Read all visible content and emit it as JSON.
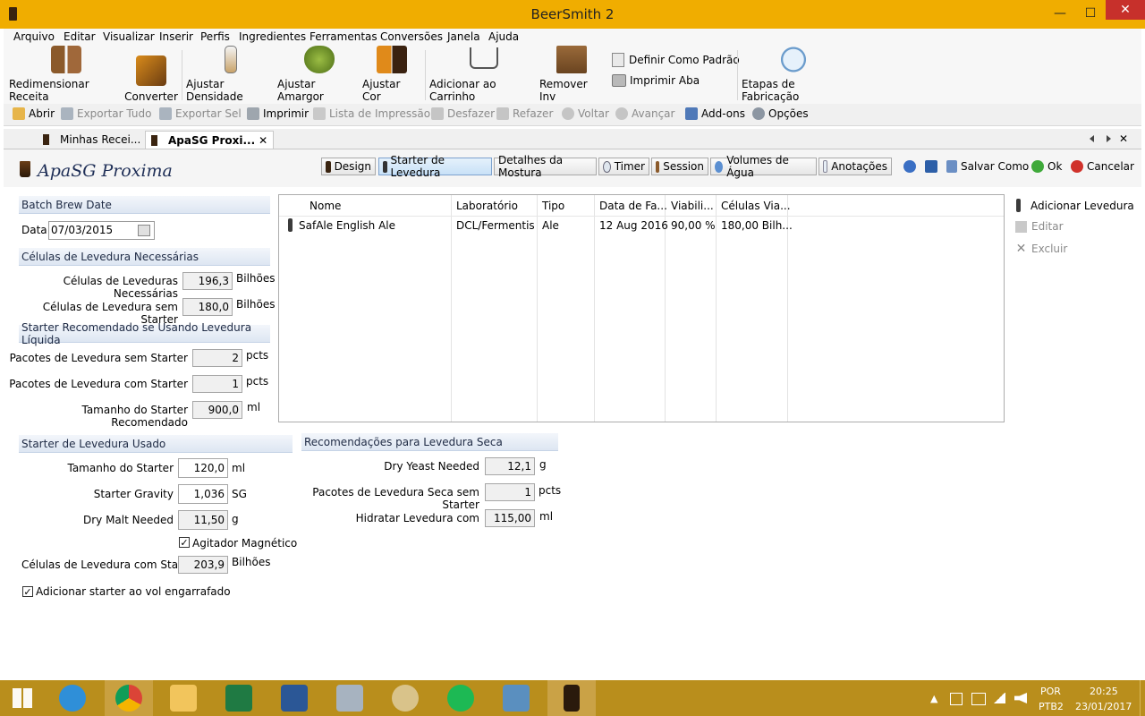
{
  "window": {
    "title": "BeerSmith 2",
    "minimize": "—",
    "maximize": "☐",
    "close": "✕"
  },
  "menu": [
    "Arquivo",
    "Editar",
    "Visualizar",
    "Inserir",
    "Perfis",
    "Ingredientes",
    "Ferramentas",
    "Conversões",
    "Janela",
    "Ajuda"
  ],
  "ribbon": {
    "resize": "Redimensionar Receita",
    "convert": "Converter",
    "density": "Ajustar Densidade",
    "bitterness": "Ajustar Amargor",
    "color": "Ajustar Cor",
    "add_cart": "Adicionar ao Carrinho",
    "remove_inv": "Remover Inv",
    "set_default": "Definir Como Padrão",
    "print_tab": "Imprimir Aba",
    "brew_steps": "Etapas de Fabricação"
  },
  "toolbar": {
    "open": "Abrir",
    "export_all": "Exportar Tudo",
    "export_sel": "Exportar Sel",
    "print": "Imprimir",
    "print_list": "Lista de Impressão",
    "undo": "Desfazer",
    "redo": "Refazer",
    "back": "Voltar",
    "forward": "Avançar",
    "addons": "Add-ons",
    "options": "Opções"
  },
  "doc_tabs": {
    "tab1": "Minhas Recei...",
    "tab2": "ApaSG  Proxi...",
    "close": "✕"
  },
  "recipe": {
    "title": "ApaSG  Proxima"
  },
  "view_tabs": {
    "design": "Design",
    "starter": "Starter de Levedura",
    "mash": "Detalhes da Mostura",
    "timer": "Timer",
    "session": "Session",
    "water": "Volumes de Água",
    "notes": "Anotações"
  },
  "actions": {
    "save_as": "Salvar Como",
    "ok": "Ok",
    "cancel": "Cancelar"
  },
  "batch": {
    "header": "Batch Brew Date",
    "date_label": "Data",
    "date_value": "07/03/2015"
  },
  "cells_needed": {
    "header": "Células de Levedura Necessárias",
    "needed_label": "Células de Leveduras Necessárias",
    "needed_value": "196,3",
    "needed_unit": "Bilhões",
    "nostarter_label": "Células de Levedura sem Starter",
    "nostarter_value": "180,0",
    "nostarter_unit": "Bilhões"
  },
  "liquid": {
    "header": "Starter Recomendado se Usando Levedura Líquida",
    "p_no_label": "Pacotes de Levedura sem Starter",
    "p_no_value": "2",
    "p_no_unit": "pcts",
    "p_with_label": "Pacotes de Levedura com Starter",
    "p_with_value": "1",
    "p_with_unit": "pcts",
    "size_label": "Tamanho do Starter Recomendado",
    "size_value": "900,0",
    "size_unit": "ml"
  },
  "used": {
    "header": "Starter de Levedura Usado",
    "size_label": "Tamanho do Starter",
    "size_value": "120,0",
    "size_unit": "ml",
    "gravity_label": "Starter Gravity",
    "gravity_value": "1,036",
    "gravity_unit": "SG",
    "malt_label": "Dry Malt Needed",
    "malt_value": "11,50",
    "malt_unit": "g",
    "stir_label": "Agitador Magnético",
    "cells_label": "Células de Levedura com Starter",
    "cells_value": "203,9",
    "cells_unit": "Bilhões",
    "add_label": "Adicionar starter ao vol engarrafado"
  },
  "dry": {
    "header": "Recomendações para Levedura Seca",
    "need_label": "Dry Yeast Needed",
    "need_value": "12,1",
    "need_unit": "g",
    "packs_label": "Pacotes de Levedura Seca sem Starter",
    "packs_value": "1",
    "packs_unit": "pcts",
    "hydrate_label": "Hidratar Levedura com",
    "hydrate_value": "115,00",
    "hydrate_unit": "ml"
  },
  "grid": {
    "columns": [
      "Nome",
      "Laboratório",
      "Tipo",
      "Data de Fa...",
      "Viabili...",
      "Células Via..."
    ],
    "row": [
      "SafAle English Ale",
      "DCL/Fermentis",
      "Ale",
      "12 Aug 2016",
      "90,00 %",
      "180,00 Bilh..."
    ]
  },
  "side": {
    "add": "Adicionar Levedura",
    "edit": "Editar",
    "delete": "Excluir"
  },
  "tray": {
    "lang1": "POR",
    "lang2": "PTB2",
    "time": "20:25",
    "date": "23/01/2017"
  }
}
